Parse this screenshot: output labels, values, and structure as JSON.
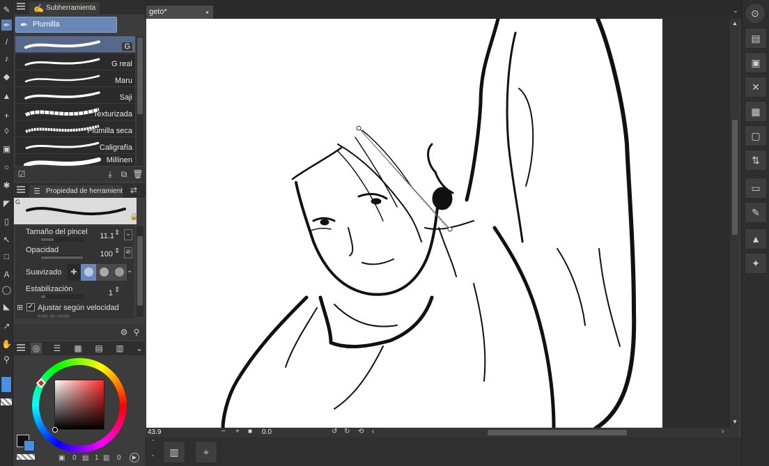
{
  "subtool_panel": {
    "tab_label": "Subherramienta",
    "selected_group": "Plumilla",
    "brushes": [
      {
        "label": "G",
        "selected": true
      },
      {
        "label": "G real",
        "selected": false
      },
      {
        "label": "Maru",
        "selected": false
      },
      {
        "label": "Saji",
        "selected": false
      },
      {
        "label": "Texturizada",
        "selected": false
      },
      {
        "label": "Plumilla seca",
        "selected": false
      },
      {
        "label": "Caligrafía",
        "selected": false
      },
      {
        "label": "Millinen",
        "selected": false
      }
    ]
  },
  "tool_property": {
    "tab_label": "Propiedad de herramient",
    "preview_label": "G",
    "brush_size_label": "Tamaño del pincel",
    "brush_size_value": "11.1",
    "opacity_label": "Opacidad",
    "opacity_value": "100",
    "smoothing_label": "Suavizado",
    "stabilization_label": "Estabilización",
    "stabilization_value": "1",
    "adjust_velocity_label": "Ajustar según velocidad",
    "adjust_velocity_checked": true,
    "hidden_row_label": "Imán de vector"
  },
  "color_panel": {
    "main_color": "#111111",
    "sub_color": "#4a90e2",
    "footer_values": [
      "0",
      "1",
      "0"
    ]
  },
  "document": {
    "tab_label": "geto*",
    "zoom_value": "43.9",
    "rotation_value": "0.0"
  },
  "colors": {
    "accent": "#6b87b6",
    "selected_row": "#56698a"
  }
}
